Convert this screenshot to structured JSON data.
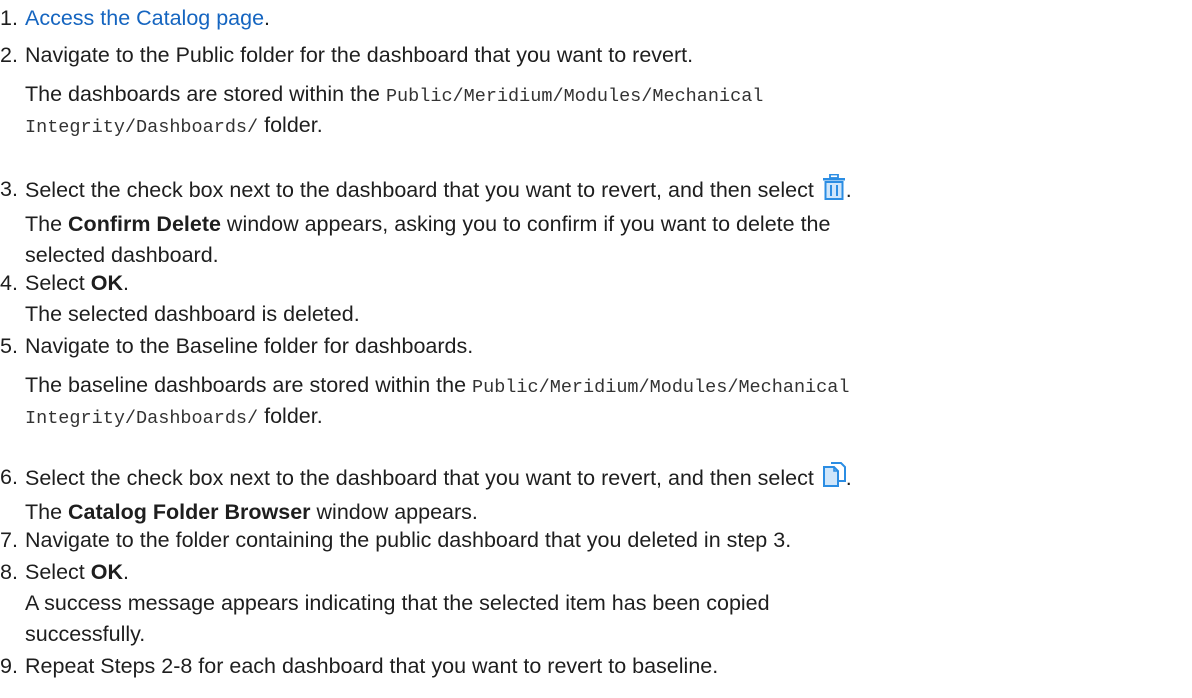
{
  "steps": [
    {
      "number": "1.",
      "link_text": "Access the Catalog page",
      "suffix": "."
    },
    {
      "number": "2.",
      "text": "Navigate to the Public folder for the dashboard that you want to revert.",
      "note_prefix": "The dashboards are stored within the ",
      "path_line1": "Public/Meridium/Modules/Mechanical",
      "path_line2": "Integrity/Dashboards/",
      "note_suffix": " folder."
    },
    {
      "number": "3.",
      "text": "Select the check box next to the dashboard that you want to revert, and then select ",
      "icon": "delete-trash-icon",
      "icon_color": "#2b8de3",
      "suffix": ".",
      "result_prefix": "The ",
      "result_bold": "Confirm Delete",
      "result_rest1": " window appears, asking you to confirm if you want to delete the",
      "result_rest2": "selected dashboard."
    },
    {
      "number": "4.",
      "prefix": "Select ",
      "bold": "OK",
      "suffix": ".",
      "result": "The selected dashboard is deleted."
    },
    {
      "number": "5.",
      "text": "Navigate to the Baseline folder for dashboards.",
      "note_prefix": "The baseline dashboards are stored within the ",
      "path_line1": "Public/Meridium/Modules/Mechanical",
      "path_line2": "Integrity/Dashboards/",
      "note_suffix": " folder."
    },
    {
      "number": "6.",
      "text": "Select the check box next to the dashboard that you want to revert, and then select ",
      "icon": "copy-icon",
      "icon_color": "#2b8de3",
      "suffix": ".",
      "result_prefix": "The ",
      "result_bold": "Catalog Folder Browser",
      "result_rest": " window appears."
    },
    {
      "number": "7.",
      "text": "Navigate to the folder containing the public dashboard that you deleted in step 3."
    },
    {
      "number": "8.",
      "prefix": "Select ",
      "bold": "OK",
      "suffix": ".",
      "result1": "A success message appears indicating that the selected item has been copied",
      "result2": "successfully."
    },
    {
      "number": "9.",
      "text": "Repeat Steps 2-8 for each dashboard that you want to revert to baseline."
    }
  ]
}
